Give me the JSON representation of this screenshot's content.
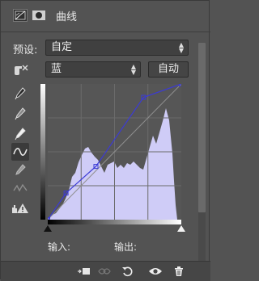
{
  "header": {
    "title": "曲线",
    "tab_icons": [
      "curves-adjustment-icon",
      "mask-icon"
    ]
  },
  "preset": {
    "label": "预设:",
    "value": "自定"
  },
  "channel": {
    "value": "蓝",
    "auto_label": "自动"
  },
  "tools": [
    "on-image-adjust-icon",
    "black-point-eyedropper-icon",
    "gray-point-eyedropper-icon",
    "white-point-eyedropper-icon",
    "curve-point-icon",
    "pencil-draw-icon",
    "smooth-icon",
    "clipping-warning-icon"
  ],
  "curve": {
    "points": [
      [
        0,
        0
      ],
      [
        35,
        50
      ],
      [
        92,
        100
      ],
      [
        183,
        230
      ],
      [
        255,
        255
      ]
    ],
    "colors": {
      "histogram": "#cfccf7",
      "curve": "#3b3ad6",
      "baseline": "#8f8f8f",
      "grid": "#6b6b6b"
    }
  },
  "readout": {
    "input_label": "输入:",
    "output_label": "输出:"
  },
  "footer": {
    "buttons": [
      "clip-to-layer-icon",
      "view-previous-state-icon",
      "reset-icon",
      "toggle-visibility-icon",
      "delete-icon"
    ]
  }
}
